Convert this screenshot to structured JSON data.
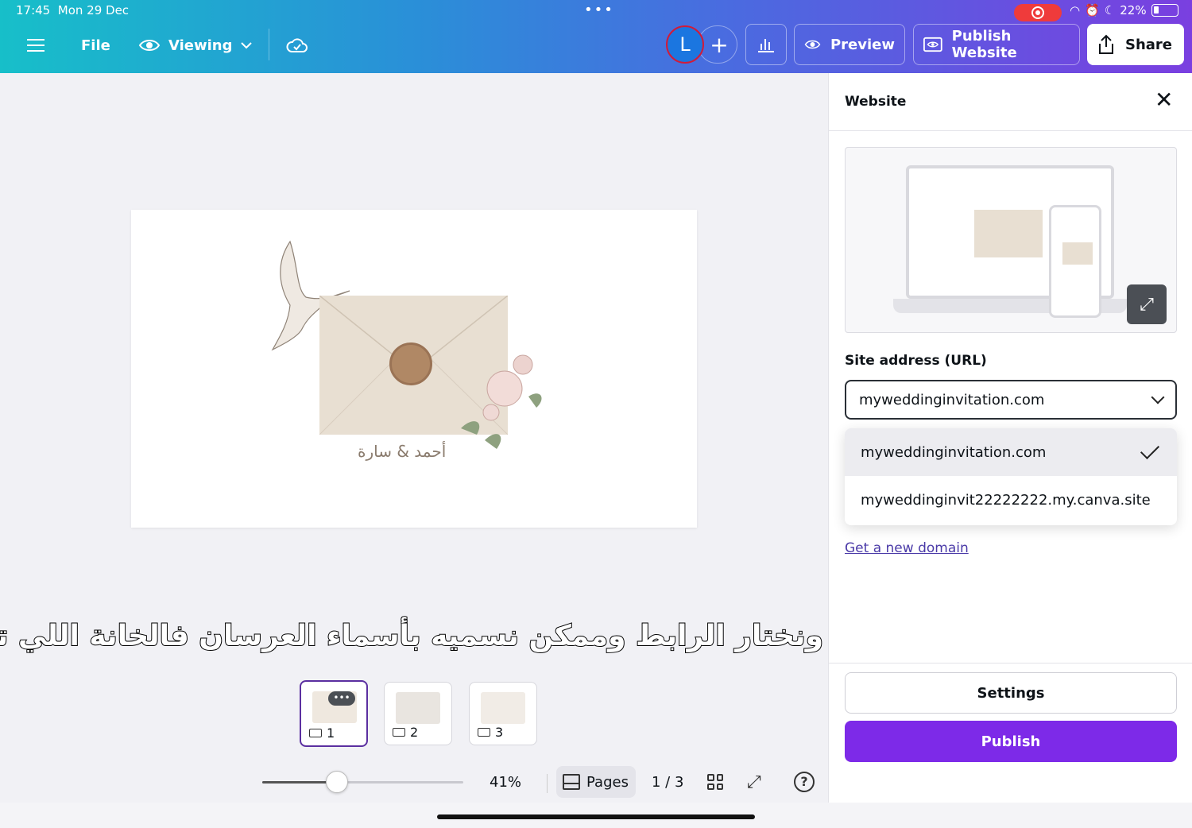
{
  "status_bar": {
    "time": "17:45",
    "date": "Mon 29 Dec",
    "battery": "22%",
    "battery_level": 0.22
  },
  "toolbar": {
    "file_label": "File",
    "viewing_label": "Viewing",
    "avatar_letter": "L",
    "preview_label": "Preview",
    "publish_website_label": "Publish Website",
    "share_label": "Share"
  },
  "design": {
    "names_text": "أحمد & سارة"
  },
  "subtitle": "نسوي publish خلاص ونختار الرابط وممكن نسميه بأسماء العرسان فالخانة اللي تحت",
  "pages": {
    "thumbnails": [
      {
        "num": "1",
        "active": true
      },
      {
        "num": "2",
        "active": false
      },
      {
        "num": "3",
        "active": false
      }
    ],
    "more_label": "•••",
    "zoom": "41%",
    "zoom_fraction": 0.37,
    "pages_label": "Pages",
    "page_count": "1 / 3",
    "help_label": "?"
  },
  "panel": {
    "title": "Website",
    "site_address_label": "Site address (URL)",
    "url_selected": "myweddinginvitation.com",
    "url_options": [
      "myweddinginvitation.com",
      "myweddinginvit22222222.my.canva.site"
    ],
    "new_domain_link": "Get a new domain",
    "settings_label": "Settings",
    "publish_label": "Publish"
  },
  "colors": {
    "accent": "#7d2ae8",
    "topbar_start": "#17bfc9",
    "topbar_end": "#7a3fe0"
  }
}
